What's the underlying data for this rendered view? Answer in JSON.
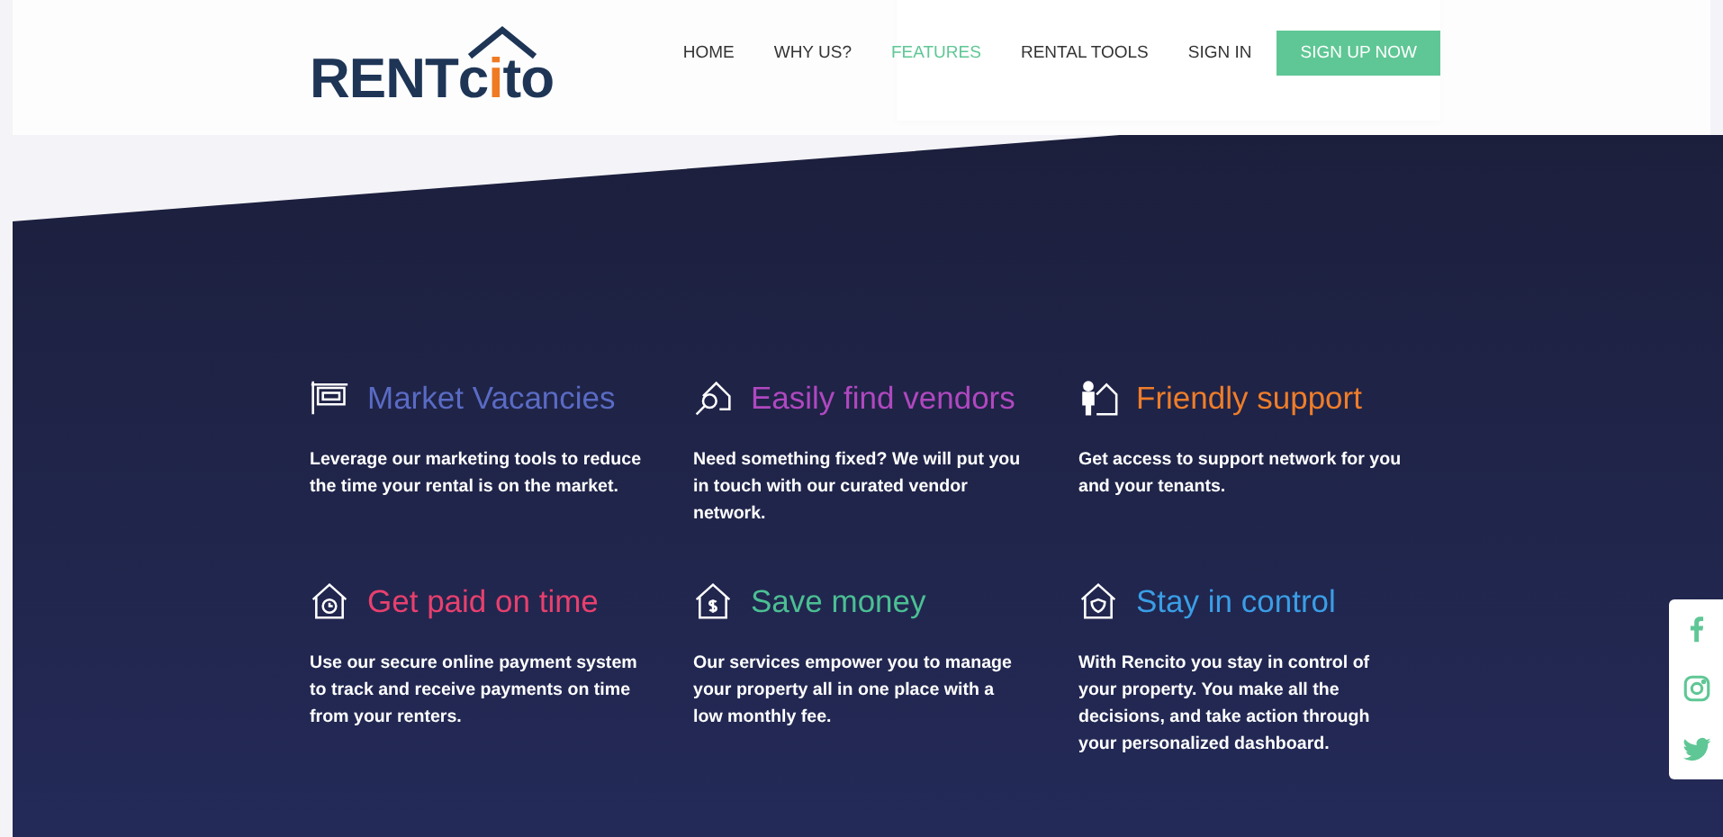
{
  "header": {
    "logo": {
      "prefix": "RENT",
      "c": "c",
      "i": "i",
      "suffix": "to"
    },
    "nav": [
      {
        "label": "HOME",
        "selected": false
      },
      {
        "label": "WHY US?",
        "selected": false
      },
      {
        "label": "FEATURES",
        "selected": true
      },
      {
        "label": "RENTAL TOOLS",
        "selected": false
      },
      {
        "label": "SIGN IN",
        "selected": false
      }
    ],
    "cta": "SIGN UP NOW"
  },
  "features": [
    {
      "kind": "sign",
      "title": "Market Vacancies",
      "color": "#5a6bc4",
      "description": "Leverage our marketing tools to reduce the time your rental is on the market."
    },
    {
      "kind": "search",
      "title": "Easily find vendors",
      "color": "#b048c0",
      "description": "Need something fixed? We will put you in touch with our curated vendor network."
    },
    {
      "kind": "person",
      "title": "Friendly support",
      "color": "#ef7d2a",
      "description": "Get access to support network for you and your tenants."
    },
    {
      "kind": "clock",
      "title": "Get paid on time",
      "color": "#e8406e",
      "description": "Use our secure online payment system to track and receive payments on time from your renters."
    },
    {
      "kind": "dollar",
      "title": "Save money",
      "color": "#4bbf93",
      "description": "Our services empower you to manage your property all in one place with a low monthly fee."
    },
    {
      "kind": "shield",
      "title": "Stay in control",
      "color": "#3a9ee6",
      "description": "With Rencito you stay in control of your property. You make all the decisions, and take action through your personalized dashboard."
    }
  ],
  "social": [
    {
      "kind": "facebook"
    },
    {
      "kind": "instagram"
    },
    {
      "kind": "twitter"
    }
  ]
}
